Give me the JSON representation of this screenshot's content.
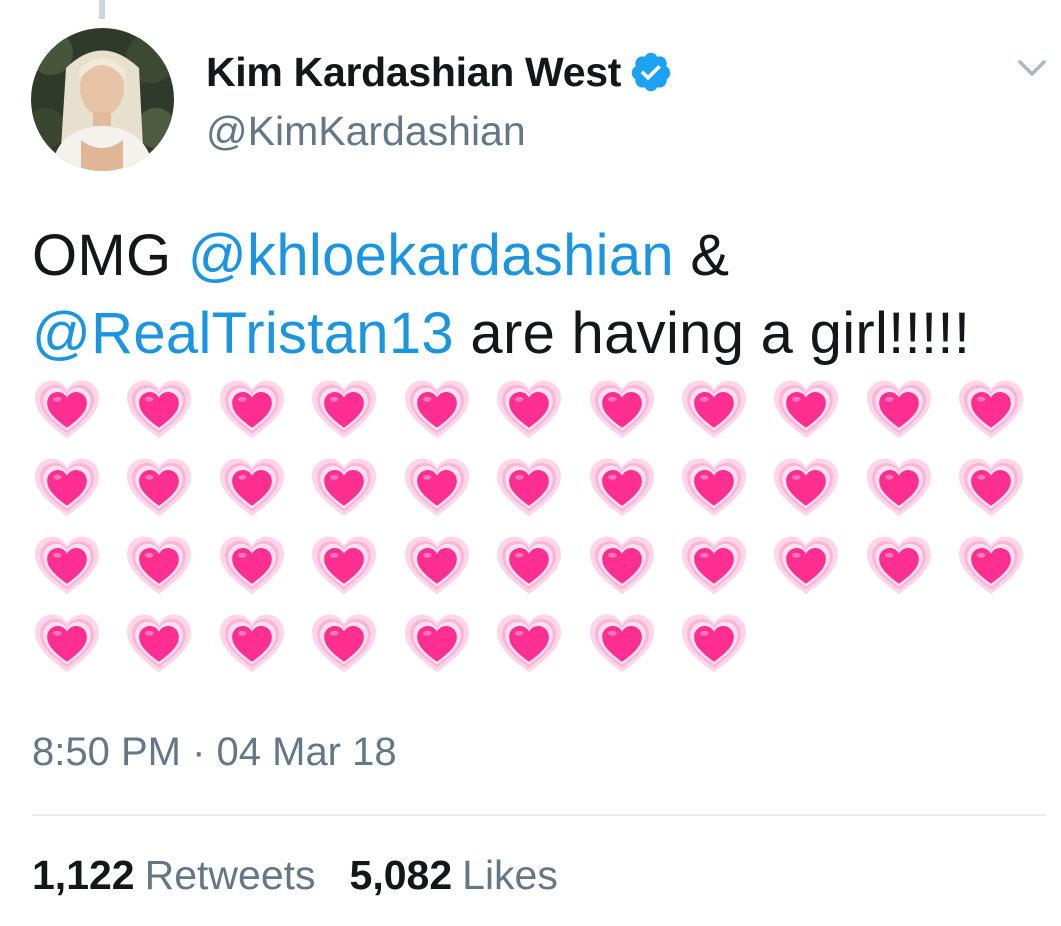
{
  "tweet": {
    "author": {
      "display_name": "Kim Kardashian West",
      "handle": "@KimKardashian",
      "verified": true
    },
    "text": {
      "prefix": "OMG ",
      "mention_1": "@khloekardashian",
      "connector": " & ",
      "mention_2": "@RealTristan13",
      "middle": " are having a girl!!!!! ",
      "emoji": "growing-heart",
      "emoji_count": 41
    },
    "timestamp": "8:50 PM · 04 Mar 18",
    "stats": {
      "retweets_count": "1,122",
      "retweets_label": "Retweets",
      "likes_count": "5,082",
      "likes_label": "Likes"
    }
  },
  "icons": {
    "verified": "verified-badge-icon",
    "menu": "chevron-down-icon",
    "heart": "growing-heart-icon"
  },
  "colors": {
    "link": "#1b95e0",
    "secondary_text": "#657786",
    "primary_text": "#14171a",
    "verified": "#1da1f2",
    "heart_core": "#ff2f92",
    "divider": "#e6ecf0"
  }
}
